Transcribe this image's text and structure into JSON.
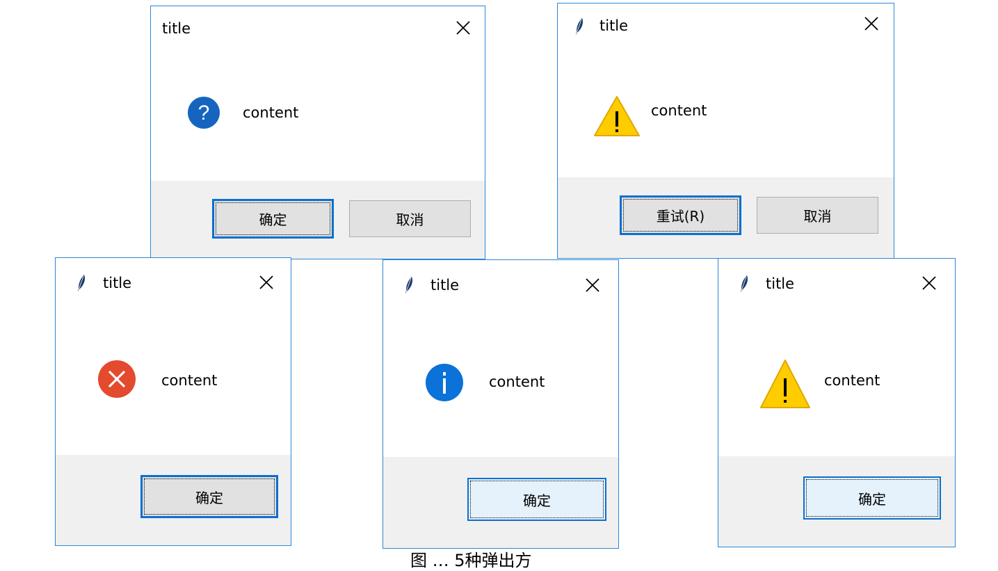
{
  "dialogs": [
    {
      "title": "title",
      "message": "content",
      "icon": "question-icon",
      "buttons": [
        "确定",
        "取消"
      ]
    },
    {
      "title": "title",
      "message": "content",
      "icon": "warning-icon",
      "buttons": [
        "重试(R)",
        "取消"
      ]
    },
    {
      "title": "title",
      "message": "content",
      "icon": "error-icon",
      "buttons": [
        "确定"
      ]
    },
    {
      "title": "title",
      "message": "content",
      "icon": "info-icon",
      "buttons": [
        "确定"
      ]
    },
    {
      "title": "title",
      "message": "content",
      "icon": "warning-icon",
      "buttons": [
        "确定"
      ]
    }
  ],
  "caption": "图 … 5种弹出方",
  "colors": {
    "border": "#2b86d8",
    "footer": "#f0f0f0",
    "button": "#e1e1e1",
    "focus": "#0b6fd0",
    "question": "#1565c0",
    "info": "#0a72d8",
    "error": "#e34a2e",
    "warning": "#ffcc00"
  }
}
